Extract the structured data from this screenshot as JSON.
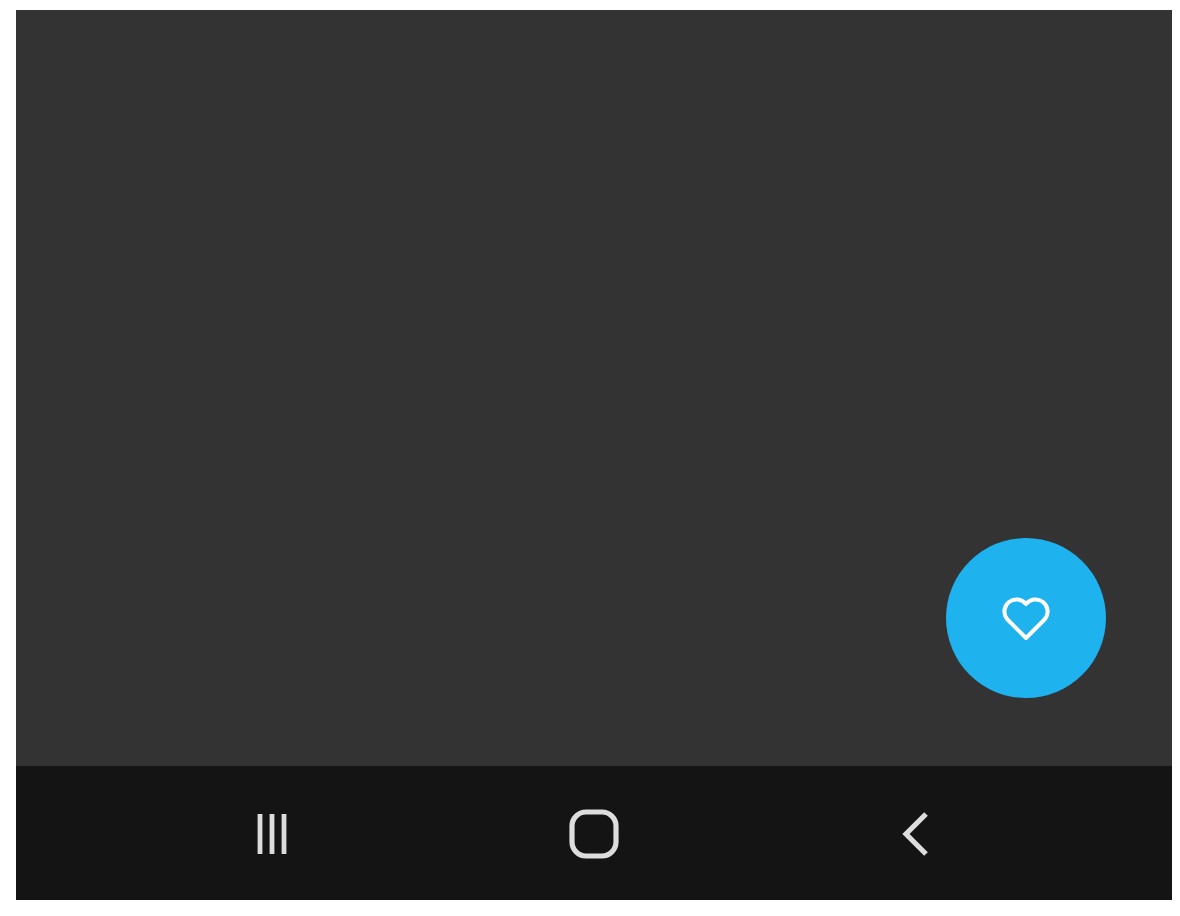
{
  "fab": {
    "kind": "favorite"
  },
  "nav_bar": {
    "buttons": [
      {
        "kind": "recents"
      },
      {
        "kind": "home"
      },
      {
        "kind": "back"
      }
    ]
  }
}
